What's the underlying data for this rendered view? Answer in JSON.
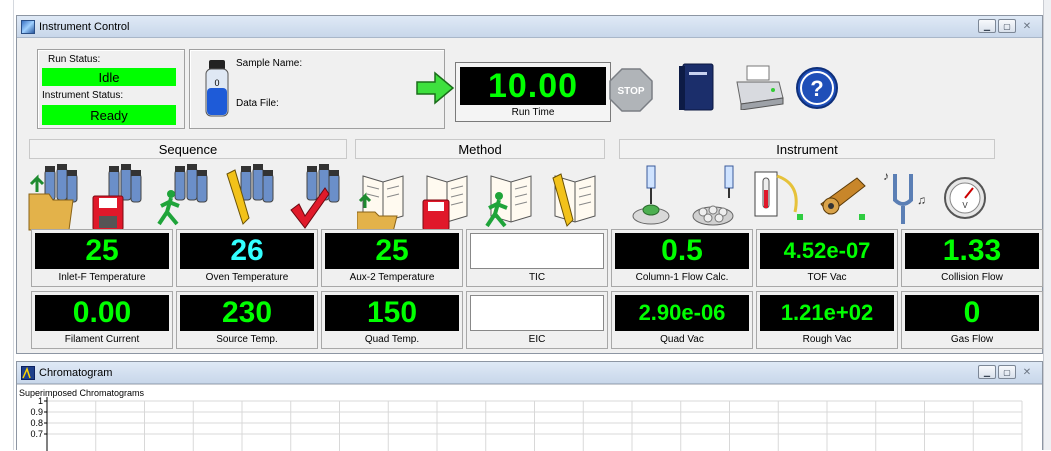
{
  "instrument_window": {
    "title": "Instrument Control",
    "run_status_label": "Run Status:",
    "run_status_value": "Idle",
    "instrument_status_label": "Instrument Status:",
    "instrument_status_value": "Ready",
    "sample_name_label": "Sample Name:",
    "data_file_label": "Data File:",
    "vial_label": "0",
    "run_time_value": "10.00",
    "run_time_label": "Run Time",
    "stop_label": "STOP",
    "help_label": "?"
  },
  "sections": {
    "sequence": "Sequence",
    "method": "Method",
    "instrument": "Instrument"
  },
  "tiles_row1": [
    {
      "value": "25",
      "label": "Inlet-F Temperature",
      "color": "#00ff00"
    },
    {
      "value": "26",
      "label": "Oven Temperature",
      "color": "#33ffff"
    },
    {
      "value": "25",
      "label": "Aux-2 Temperature",
      "color": "#00ff00"
    },
    {
      "value": "",
      "label": "TIC",
      "color": "#000000"
    },
    {
      "value": "0.5",
      "label": "Column-1 Flow Calc.",
      "color": "#00ff00"
    },
    {
      "value": "4.52e-07",
      "label": "TOF Vac",
      "color": "#00ff00"
    },
    {
      "value": "1.33",
      "label": "Collision Flow",
      "color": "#00ff00"
    }
  ],
  "tiles_row2": [
    {
      "value": "0.00",
      "label": "Filament Current",
      "color": "#00ff00"
    },
    {
      "value": "230",
      "label": "Source Temp.",
      "color": "#00ff00"
    },
    {
      "value": "150",
      "label": "Quad Temp.",
      "color": "#00ff00"
    },
    {
      "value": "",
      "label": "EIC",
      "color": "#000000"
    },
    {
      "value": "2.90e-06",
      "label": "Quad Vac",
      "color": "#00ff00"
    },
    {
      "value": "1.21e+02",
      "label": "Rough Vac",
      "color": "#00ff00"
    },
    {
      "value": "0",
      "label": "Gas Flow",
      "color": "#00ff00"
    }
  ],
  "chromatogram_window": {
    "title": "Chromatogram",
    "plot_title": "Superimposed Chromatograms",
    "y_ticks": [
      "1",
      "0.9",
      "0.8",
      "0.7"
    ]
  },
  "icons": {
    "sequence": [
      "sequence-open-icon",
      "sequence-save-icon",
      "sequence-run-icon",
      "sequence-edit-icon",
      "sequence-check-icon"
    ],
    "method": [
      "method-open-icon",
      "method-save-icon",
      "method-run-icon",
      "method-edit-icon"
    ],
    "instrument": [
      "injector-icon",
      "autosampler-icon",
      "oven-icon",
      "ion-source-icon",
      "tuning-fork-icon",
      "vacuum-gauge-icon"
    ]
  }
}
